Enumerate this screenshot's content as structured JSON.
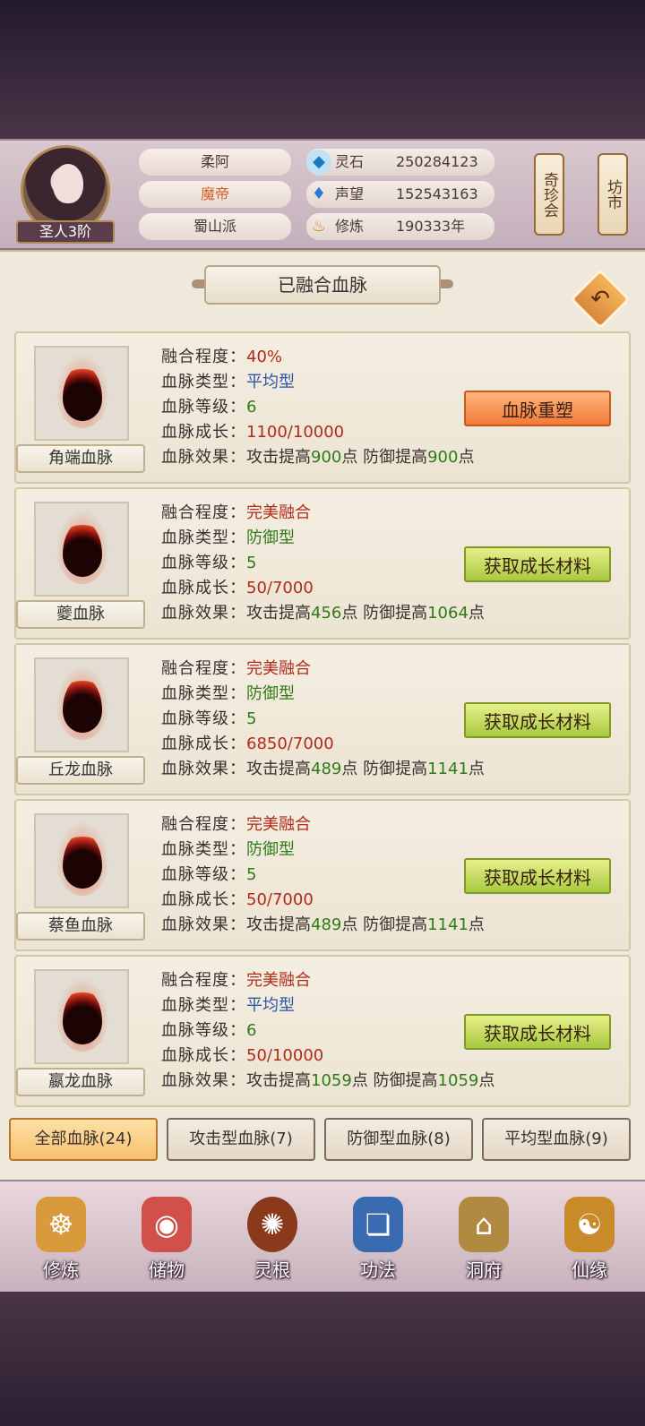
{
  "player": {
    "name": "柔阿",
    "title": "魔帝",
    "sect": "蜀山派",
    "rank": "圣人3阶"
  },
  "resources": [
    {
      "label": "灵石",
      "value": "250284123",
      "icon": "spirit-stone-icon"
    },
    {
      "label": "声望",
      "value": "152543163",
      "icon": "reputation-icon"
    },
    {
      "label": "修炼",
      "value": "190333年",
      "icon": "cultivation-icon"
    }
  ],
  "lanterns": [
    {
      "label": "奇珍会"
    },
    {
      "label": "坊市"
    }
  ],
  "panel_title": "已融合血脉",
  "field_labels": {
    "fusion": "融合程度：",
    "type": "血脉类型：",
    "level": "血脉等级：",
    "growth": "血脉成长：",
    "effect": "血脉效果："
  },
  "effect_words": {
    "attack": "攻击提高",
    "defense": "防御提高",
    "unit": "点"
  },
  "bloodlines": [
    {
      "name": "角端血脉",
      "fusion": "40%",
      "type": "平均型",
      "level": "6",
      "growth": "1100/10000",
      "atk": "900",
      "def": "900",
      "button": "血脉重塑"
    },
    {
      "name": "夔血脉",
      "fusion": "完美融合",
      "type": "防御型",
      "level": "5",
      "growth": "50/7000",
      "atk": "456",
      "def": "1064",
      "button": "获取成长材料"
    },
    {
      "name": "丘龙血脉",
      "fusion": "完美融合",
      "type": "防御型",
      "level": "5",
      "growth": "6850/7000",
      "atk": "489",
      "def": "1141",
      "button": "获取成长材料"
    },
    {
      "name": "蔡鱼血脉",
      "fusion": "完美融合",
      "type": "防御型",
      "level": "5",
      "growth": "50/7000",
      "atk": "489",
      "def": "1141",
      "button": "获取成长材料"
    },
    {
      "name": "嬴龙血脉",
      "fusion": "完美融合",
      "type": "平均型",
      "level": "6",
      "growth": "50/10000",
      "atk": "1059",
      "def": "1059",
      "button": "获取成长材料"
    }
  ],
  "filters": [
    {
      "label": "全部血脉(24)",
      "active": true
    },
    {
      "label": "攻击型血脉(7)",
      "active": false
    },
    {
      "label": "防御型血脉(8)",
      "active": false
    },
    {
      "label": "平均型血脉(9)",
      "active": false
    }
  ],
  "nav": [
    {
      "label": "修炼",
      "icon": "monk-icon"
    },
    {
      "label": "储物",
      "icon": "bag-icon"
    },
    {
      "label": "灵根",
      "icon": "spirit-root-icon"
    },
    {
      "label": "功法",
      "icon": "book-icon"
    },
    {
      "label": "洞府",
      "icon": "palace-icon"
    },
    {
      "label": "仙缘",
      "icon": "gourd-icon"
    }
  ]
}
